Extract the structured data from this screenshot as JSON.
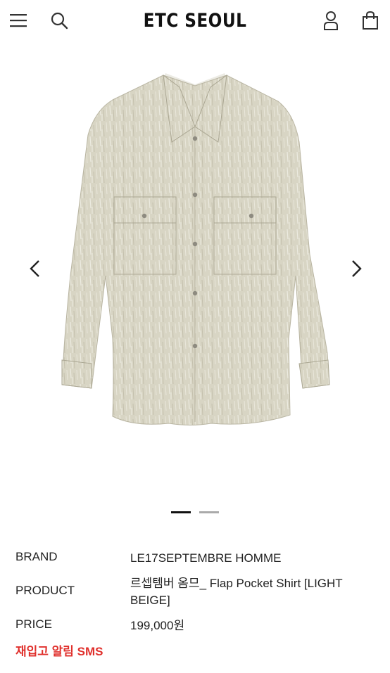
{
  "header": {
    "logo": "ETC SEOUL",
    "icons": [
      "menu-icon",
      "search-icon",
      "account-icon",
      "shopping-bag-icon"
    ]
  },
  "gallery": {
    "image": "Flap Pocket Shirt product photo (light beige)",
    "slide_count": 2,
    "active_slide": 1
  },
  "product": {
    "brand_label": "BRAND",
    "brand_value": "LE17SEPTEMBRE HOMME",
    "product_label": "PRODUCT",
    "product_value": "르셉템버 옴므_ Flap Pocket Shirt [LIGHT BEIGE]",
    "price_label": "PRICE",
    "price_value": "199,000원",
    "restock_sms": "재입고 알림 SMS"
  },
  "colors": {
    "accent_red": "#e0302c",
    "shirt_beige": "#d9d6c5"
  }
}
